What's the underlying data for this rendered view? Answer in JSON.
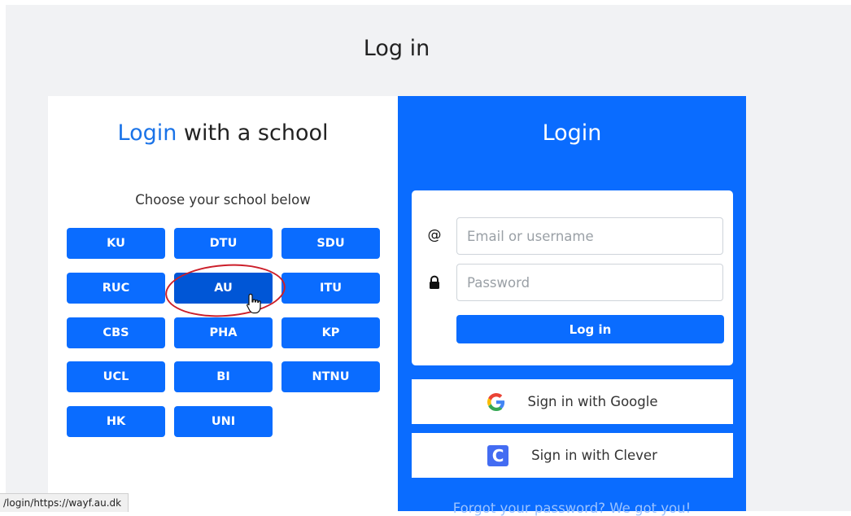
{
  "page": {
    "title": "Log in"
  },
  "school_panel": {
    "heading_accent": "Login",
    "heading_rest": " with a school",
    "prompt": "Choose your school below",
    "schools": [
      "KU",
      "DTU",
      "SDU",
      "RUC",
      "AU",
      "ITU",
      "CBS",
      "PHA",
      "KP",
      "UCL",
      "BI",
      "NTNU",
      "HK",
      "UNI"
    ],
    "hovered": "AU"
  },
  "login_panel": {
    "heading": "Login",
    "email_icon": "@",
    "email_placeholder": "Email or username",
    "password_placeholder": "Password",
    "submit_label": "Log in",
    "google_label": "Sign in with Google",
    "clever_label": "Sign in with Clever",
    "clever_icon_letter": "C",
    "forgot_text": "Forgot your password? We got you!"
  },
  "status_bar": {
    "url": "/login/https://wayf.au.dk"
  },
  "colors": {
    "primary": "#0a6cff",
    "accent_text": "#1a73e8",
    "highlight": "#cc1f2a"
  }
}
